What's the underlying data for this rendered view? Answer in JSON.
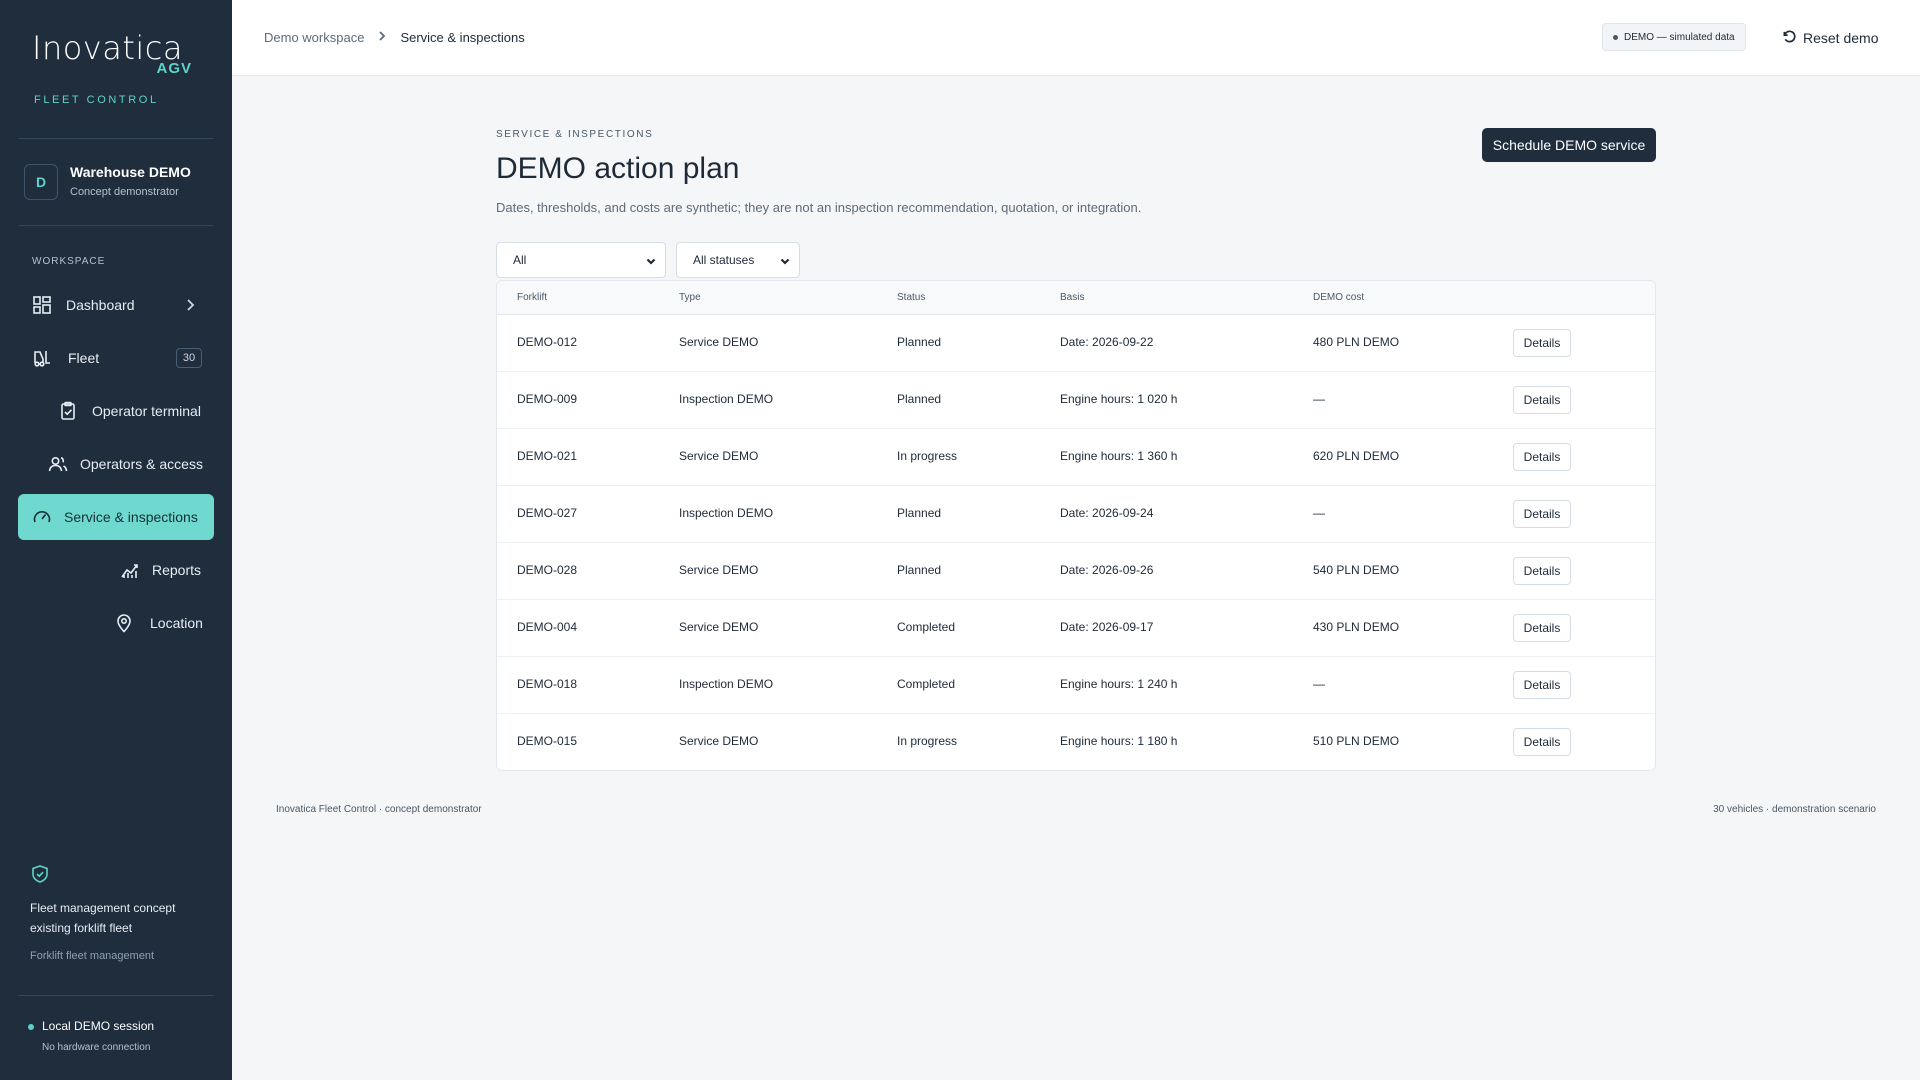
{
  "brand": {
    "name": "Inovatica",
    "suffix": "AGV",
    "tagline": "FLEET CONTROL"
  },
  "workspace": {
    "avatar": "D",
    "name": "Warehouse DEMO",
    "subtitle": "Concept demonstrator"
  },
  "sidebar": {
    "section_label": "WORKSPACE",
    "items": [
      {
        "label": "Dashboard",
        "icon": "dashboard-icon",
        "has_chevron": true
      },
      {
        "label": "Fleet",
        "icon": "forklift-icon",
        "badge": "30"
      },
      {
        "label": "Operator terminal",
        "icon": "clipboard-check-icon"
      },
      {
        "label": "Operators & access",
        "icon": "users-icon"
      },
      {
        "label": "Service & inspections",
        "icon": "gauge-icon",
        "active": true
      },
      {
        "label": "Reports",
        "icon": "chart-icon"
      },
      {
        "label": "Location",
        "icon": "map-pin-icon"
      }
    ],
    "footer": {
      "text": "Fleet management concept existing forklift fleet",
      "subtext": "Forklift fleet management",
      "session_title": "Local DEMO session",
      "session_sub": "No hardware connection"
    }
  },
  "topbar": {
    "breadcrumb": [
      "Demo workspace",
      "Service & inspections"
    ],
    "demo_pill": "DEMO — simulated data",
    "reset_label": "Reset demo"
  },
  "main": {
    "eyebrow": "SERVICE & INSPECTIONS",
    "title": "DEMO action plan",
    "description": "Dates, thresholds, and costs are synthetic; they are not an inspection recommendation, quotation, or integration.",
    "primary_button": "Schedule DEMO service",
    "filters": {
      "type_selected": "All",
      "status_selected": "All statuses"
    },
    "table": {
      "columns": [
        "Forklift",
        "Type",
        "Status",
        "Basis",
        "DEMO cost"
      ],
      "details_label": "Details",
      "rows": [
        {
          "forklift": "DEMO-012",
          "type": "Service DEMO",
          "status": "Planned",
          "basis": "Date: 2026-09-22",
          "cost": "480 PLN DEMO"
        },
        {
          "forklift": "DEMO-009",
          "type": "Inspection DEMO",
          "status": "Planned",
          "basis": "Engine hours: 1 020 h",
          "cost": "—"
        },
        {
          "forklift": "DEMO-021",
          "type": "Service DEMO",
          "status": "In progress",
          "basis": "Engine hours: 1 360 h",
          "cost": "620 PLN DEMO"
        },
        {
          "forklift": "DEMO-027",
          "type": "Inspection DEMO",
          "status": "Planned",
          "basis": "Date: 2026-09-24",
          "cost": "—"
        },
        {
          "forklift": "DEMO-028",
          "type": "Service DEMO",
          "status": "Planned",
          "basis": "Date: 2026-09-26",
          "cost": "540 PLN DEMO"
        },
        {
          "forklift": "DEMO-004",
          "type": "Service DEMO",
          "status": "Completed",
          "basis": "Date: 2026-09-17",
          "cost": "430 PLN DEMO"
        },
        {
          "forklift": "DEMO-018",
          "type": "Inspection DEMO",
          "status": "Completed",
          "basis": "Engine hours: 1 240 h",
          "cost": "—"
        },
        {
          "forklift": "DEMO-015",
          "type": "Service DEMO",
          "status": "In progress",
          "basis": "Engine hours: 1 180 h",
          "cost": "510 PLN DEMO"
        }
      ]
    }
  },
  "footer": {
    "left": "Inovatica Fleet Control · concept demonstrator",
    "right": "30 vehicles · demonstration scenario"
  },
  "colors": {
    "sidebar_bg": "#1f2d3d",
    "accent": "#6fd8cf",
    "brand_accent": "#5ed3cb",
    "page_bg": "#f4f6f8"
  }
}
